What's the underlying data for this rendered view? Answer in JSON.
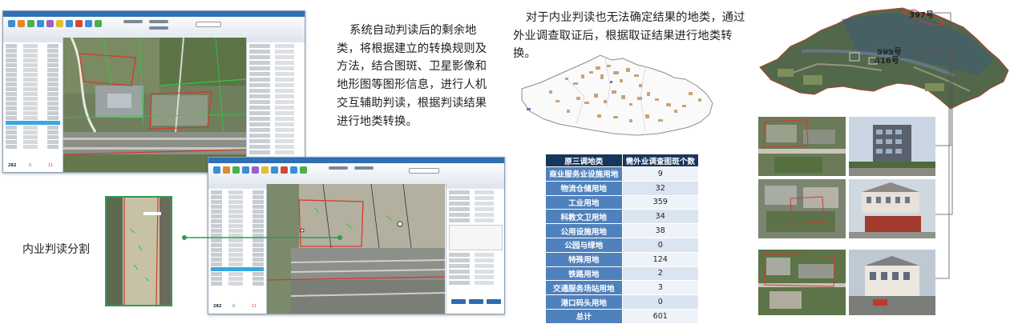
{
  "left_section": {
    "caption": "内业判读分割",
    "paragraph_lines": [
      "系统自动判读后的剩余地",
      "类，将根据建立的转换规则及",
      "方法，结合图斑、卫星影像和",
      "地形图等图形信息，进行人机",
      "交互辅助判读，根据判读结果",
      "进行地类转换。"
    ]
  },
  "screenshot_1": {
    "stats": [
      "282",
      "0",
      "11"
    ]
  },
  "screenshot_2": {
    "stats": [
      "282",
      "0",
      "11"
    ]
  },
  "middle_section": {
    "paragraph_lines": [
      "对于内业判读也无法确定结果的地类，通过",
      "外业调查取证后，根据取证结果进行地类转换。"
    ]
  },
  "table": {
    "headers": [
      "原三调地类",
      "需外业调查图斑个数"
    ],
    "rows": [
      {
        "category": "商业服务业设施用地",
        "count": "9"
      },
      {
        "category": "物流仓储用地",
        "count": "32"
      },
      {
        "category": "工业用地",
        "count": "359"
      },
      {
        "category": "科教文卫用地",
        "count": "34"
      },
      {
        "category": "公用设施用地",
        "count": "38"
      },
      {
        "category": "公园与绿地",
        "count": "0"
      },
      {
        "category": "特殊用地",
        "count": "124"
      },
      {
        "category": "铁路用地",
        "count": "2"
      },
      {
        "category": "交通服务场站用地",
        "count": "3"
      },
      {
        "category": "港口码头用地",
        "count": "0"
      },
      {
        "category": "总计",
        "count": "601"
      }
    ]
  },
  "right_section": {
    "labels": [
      "397号",
      "595号",
      "416号"
    ]
  },
  "colors": {
    "table_header": "#17365d",
    "table_category": "#4f81bd",
    "table_value": "#dbe5f1",
    "connector_green": "#2e9b54",
    "window_titlebar": "#2f6fb4",
    "parcel_red": "#d23a2e"
  }
}
